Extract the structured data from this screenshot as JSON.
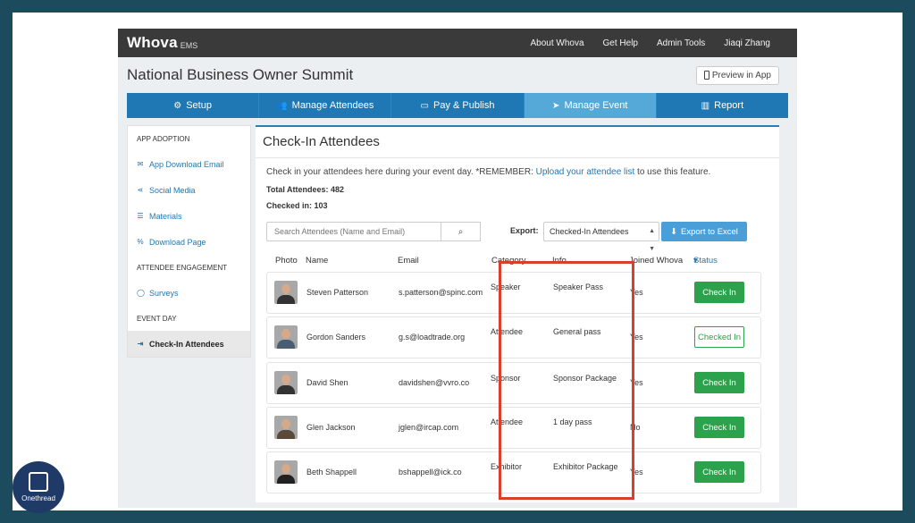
{
  "app": {
    "brand": "Whova",
    "brand_sub": "EMS",
    "nav_links": [
      "About Whova",
      "Get Help",
      "Admin Tools",
      "Jiaqi Zhang"
    ]
  },
  "event": {
    "title": "National Business Owner Summit",
    "preview_label": "Preview in App"
  },
  "tabs": [
    {
      "label": "Setup",
      "icon": "gear-icon"
    },
    {
      "label": "Manage Attendees",
      "icon": "users-icon"
    },
    {
      "label": "Pay & Publish",
      "icon": "credit-card-icon"
    },
    {
      "label": "Manage Event",
      "icon": "paper-plane-icon",
      "active": true
    },
    {
      "label": "Report",
      "icon": "bar-chart-icon"
    }
  ],
  "sidebar": {
    "section_app_adoption": "APP ADOPTION",
    "items_app": [
      {
        "label": "App Download Email",
        "icon": "envelope-icon"
      },
      {
        "label": "Social Media",
        "icon": "share-icon"
      },
      {
        "label": "Materials",
        "icon": "list-icon"
      },
      {
        "label": "Download Page",
        "icon": "link-icon"
      }
    ],
    "section_engagement": "ATTENDEE ENGAGEMENT",
    "item_surveys": {
      "label": "Surveys",
      "icon": "comment-icon"
    },
    "section_event_day": "EVENT DAY",
    "item_checkin": {
      "label": "Check-In Attendees",
      "icon": "sign-in-icon"
    }
  },
  "main": {
    "title": "Check-In Attendees",
    "notice_prefix": "Check in your attendees here during your event day. *REMEMBER: ",
    "notice_link": "Upload your attendee list",
    "notice_suffix": " to use this feature.",
    "total_attendees": "Total Attendees: 482",
    "checked_in": "Checked in: 103",
    "search_placeholder": "Search Attendees (Name and Email)",
    "export_label": "Export:",
    "export_value": "Checked-In Attendees",
    "excel_label": "Export to Excel"
  },
  "table": {
    "headers": {
      "photo": "Photo",
      "name": "Name",
      "email": "Email",
      "category": "Category",
      "info": "Info",
      "joined": "Joined Whova",
      "status": "Status"
    },
    "rows": [
      {
        "name": "Steven Patterson",
        "email": "s.patterson@spinc.com",
        "category": "Speaker",
        "info": "Speaker Pass",
        "joined": "Yes",
        "action": "Check In",
        "checked": false
      },
      {
        "name": "Gordon Sanders",
        "email": "g.s@loadtrade.org",
        "category": "Attendee",
        "info": "General pass",
        "joined": "Yes",
        "action": "Checked In",
        "checked": true
      },
      {
        "name": "David Shen",
        "email": "davidshen@vvro.co",
        "category": "Sponsor",
        "info": "Sponsor Package",
        "joined": "Yes",
        "action": "Check In",
        "checked": false
      },
      {
        "name": "Glen Jackson",
        "email": "jglen@ircap.com",
        "category": "Attendee",
        "info": "1 day pass",
        "joined": "No",
        "action": "Check In",
        "checked": false
      },
      {
        "name": "Beth Shappell",
        "email": "bshappell@ick.co",
        "category": "Exhibitor",
        "info": "Exhibitor Package",
        "joined": "Yes",
        "action": "Check In",
        "checked": false
      }
    ]
  },
  "watermark": {
    "label": "Onethread"
  },
  "colors": {
    "frame": "#1d4b5e",
    "tab_bar": "#1f78b4",
    "tab_active": "#55a9d8",
    "check_in_green": "#2ca24c",
    "highlight_red": "#d9402b"
  }
}
